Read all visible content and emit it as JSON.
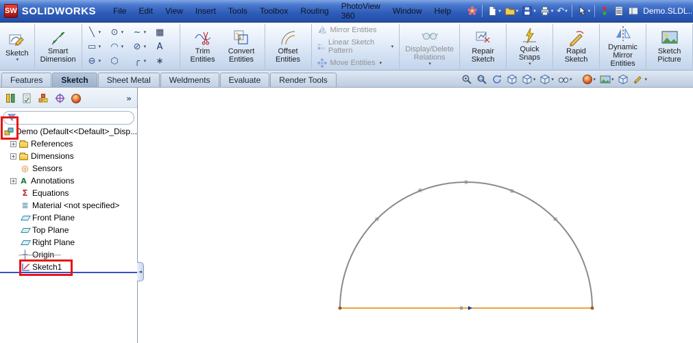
{
  "titlebar": {
    "logo_badge": "SW",
    "app_name": "SOLIDWORKS",
    "document_name": "Demo.SLDL...",
    "menus": [
      "File",
      "Edit",
      "View",
      "Insert",
      "Tools",
      "Toolbox",
      "Routing",
      "PhotoView 360",
      "Window",
      "Help"
    ],
    "quick_access_icons": [
      "new-document",
      "open",
      "save",
      "print",
      "undo",
      "select-cursor",
      "toggle-colors",
      "calculator",
      "panels"
    ]
  },
  "glyphs": {
    "caret": "▾",
    "chevron": "»",
    "plus": "+",
    "undo": "↶",
    "collapse": "◄"
  },
  "ribbon": {
    "buttons": {
      "sketch": "Sketch",
      "smart_dimension": "Smart Dimension",
      "trim_entities": "Trim Entities",
      "convert_entities": "Convert Entities",
      "offset_entities": "Offset Entities",
      "mirror_entities": "Mirror Entities",
      "linear_sketch_pattern": "Linear Sketch Pattern",
      "move_entities": "Move Entities",
      "display_delete_relations": "Display/Delete Relations",
      "repair_sketch": "Repair Sketch",
      "quick_snaps": "Quick Snaps",
      "rapid_sketch": "Rapid Sketch",
      "dynamic_mirror_entities": "Dynamic Mirror Entities",
      "sketch_picture": "Sketch Picture"
    }
  },
  "tools": {
    "line": "╲",
    "circle": "⊙",
    "spline": "~",
    "corner_rectangle": "▦",
    "rectangle": "▭",
    "arc": "◠",
    "ellipse": "⊘",
    "text": "A",
    "slot": "⊖",
    "polygon": "⬡",
    "fillet": "╭",
    "point": "∗"
  },
  "tabs": [
    "Features",
    "Sketch",
    "Sheet Metal",
    "Weldments",
    "Evaluate",
    "Render Tools"
  ],
  "view_toolbar_icons": [
    "zoom-to-fit",
    "zoom-to-area",
    "rotate-view",
    "view-orientation",
    "display-style",
    "section-view",
    "hide-show-items",
    "edit-appearance",
    "apply-scene",
    "view-settings",
    "sketch-mode"
  ],
  "feature_tree": {
    "filter": {
      "value": ""
    },
    "root": "Demo  (Default<<Default>_Disp...",
    "items": [
      {
        "label": "References",
        "icon": "folder-icon"
      },
      {
        "label": "Dimensions",
        "icon": "folder-icon"
      },
      {
        "label": "Sensors",
        "icon": "sensors-icon"
      },
      {
        "label": "Annotations",
        "icon": "annotations-icon"
      },
      {
        "label": "Equations",
        "icon": "equations-icon"
      },
      {
        "label": "Material <not specified>",
        "icon": "material-icon"
      },
      {
        "label": "Front Plane",
        "icon": "plane-icon"
      },
      {
        "label": "Top Plane",
        "icon": "plane-icon"
      },
      {
        "label": "Right Plane",
        "icon": "plane-icon"
      },
      {
        "label": "Origin",
        "icon": "origin-icon"
      },
      {
        "label": "Sketch1",
        "icon": "sketch-icon"
      }
    ]
  },
  "canvas": {
    "entities": [
      {
        "type": "arc",
        "shape": "semicircle",
        "color": "#8a8a8a"
      },
      {
        "type": "line",
        "orientation": "horizontal",
        "color": "#e8a33c"
      }
    ],
    "point_markers": 6
  },
  "annotations": {
    "highlight_color": "#e81414",
    "rollback_bar_color": "#3350c4",
    "highlighted_items": [
      "part-root-icon",
      "Sketch1"
    ]
  }
}
